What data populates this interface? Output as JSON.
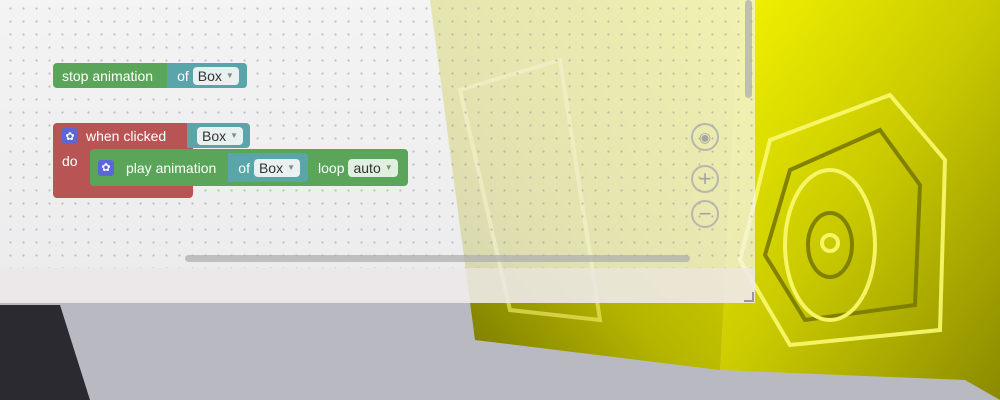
{
  "blocks": {
    "stop_animation": {
      "label": "stop animation",
      "of_label": "of",
      "target": "Box"
    },
    "when_clicked": {
      "label": "when clicked",
      "target": "Box",
      "do_label": "do"
    },
    "play_animation": {
      "label": "play animation",
      "of_label": "of",
      "target": "Box",
      "loop_label": "loop",
      "loop_value": "auto"
    }
  },
  "colors": {
    "green_block": "#5ba55b",
    "red_block": "#b85454",
    "teal_block": "#5aa5aa",
    "object_yellow": "#d6d600"
  },
  "icons": {
    "gear": "gear-icon",
    "recenter": "target-icon",
    "zoom_in": "zoom-in-icon",
    "zoom_out": "zoom-out-icon"
  }
}
